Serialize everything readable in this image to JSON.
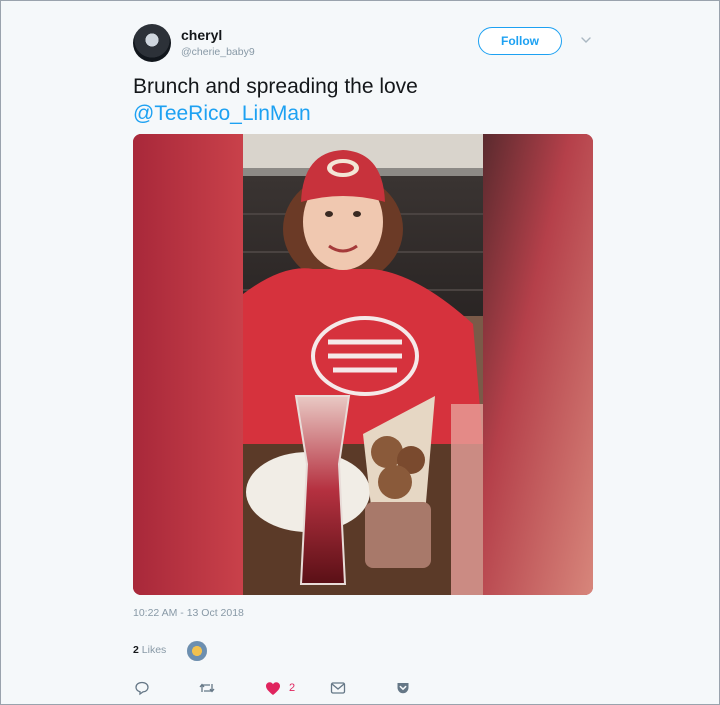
{
  "user": {
    "display_name": "cheryl",
    "handle": "@cherie_baby9"
  },
  "follow_button": {
    "label": "Follow"
  },
  "tweet": {
    "text": "Brunch and spreading the love",
    "mention": "@TeeRico_LinMan",
    "timestamp": "10:22 AM - 13 Oct 2018"
  },
  "stats": {
    "likes_count": "2",
    "likes_label": "Likes"
  },
  "actions": {
    "like_count": "2"
  },
  "icons": [
    "reply-icon",
    "retweet-icon",
    "heart-icon",
    "message-icon",
    "pocket-icon",
    "chevron-down-icon"
  ],
  "colors": {
    "accent": "#1da1f2",
    "like": "#e0245e",
    "muted": "#8899a6"
  }
}
